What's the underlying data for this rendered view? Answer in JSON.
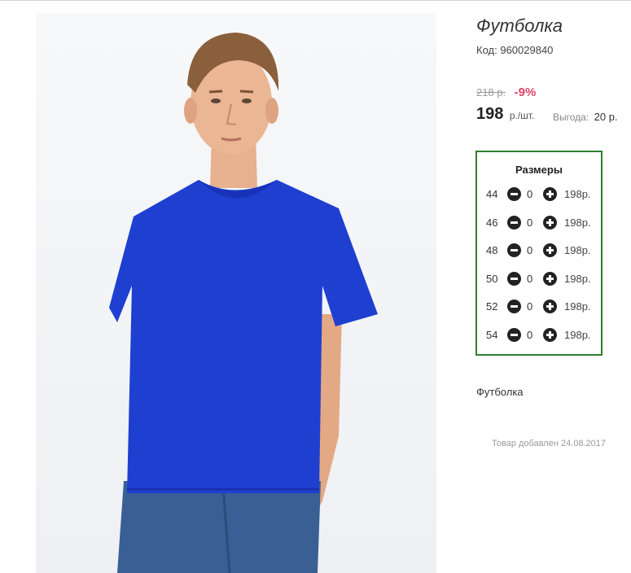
{
  "product": {
    "title": "Футболка",
    "code_label": "Код:",
    "code_value": "960029840",
    "old_price": "218 р.",
    "discount": "-9%",
    "price": "198",
    "price_unit": "р./шт.",
    "benefit_label": "Выгода:",
    "benefit_value": "20 р.",
    "description": "Футболка",
    "added": "Товар добавлен 24.08.2017",
    "photo_colors": {
      "shirt": "#1f3fd1",
      "jeans": "#3a5f95",
      "background": "#f2f4f6"
    }
  },
  "sizes": {
    "heading": "Размеры",
    "border_color": "#2f7f2f",
    "rows": [
      {
        "size": "44",
        "qty": "0",
        "price": "198р."
      },
      {
        "size": "46",
        "qty": "0",
        "price": "198р."
      },
      {
        "size": "48",
        "qty": "0",
        "price": "198р."
      },
      {
        "size": "50",
        "qty": "0",
        "price": "198р."
      },
      {
        "size": "52",
        "qty": "0",
        "price": "198р."
      },
      {
        "size": "54",
        "qty": "0",
        "price": "198р."
      }
    ]
  }
}
